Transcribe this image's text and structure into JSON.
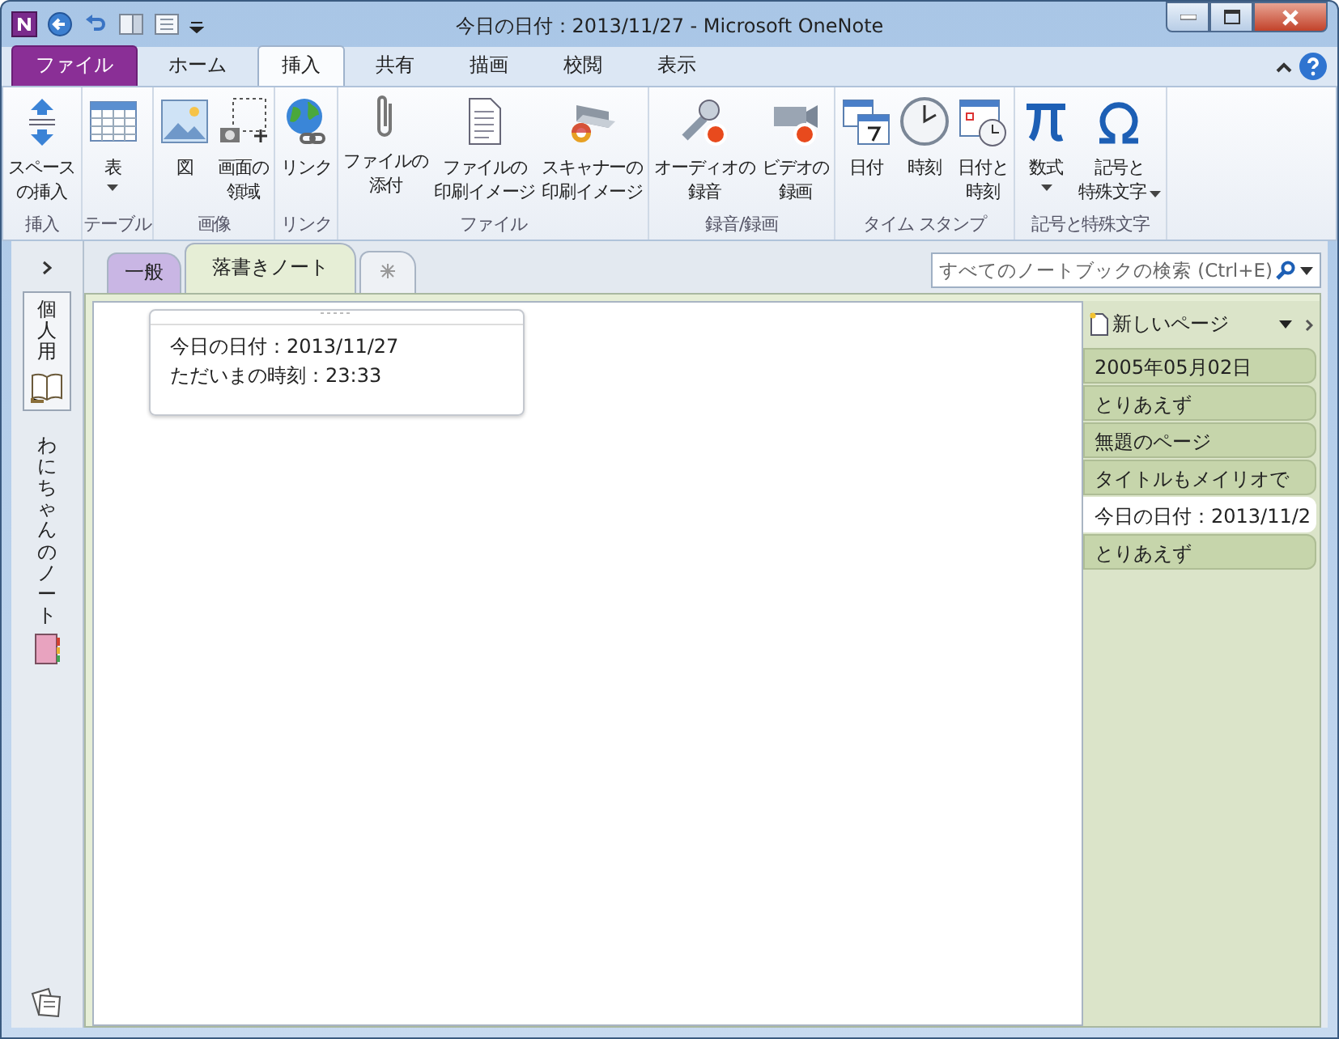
{
  "window": {
    "title": "今日の日付：2013/11/27 - Microsoft OneNote"
  },
  "ribbon_tabs": [
    {
      "label": "ファイル",
      "kind": "file",
      "selected": false
    },
    {
      "label": "ホーム",
      "kind": "tab",
      "selected": false
    },
    {
      "label": "挿入",
      "kind": "tab",
      "selected": true
    },
    {
      "label": "共有",
      "kind": "tab",
      "selected": false
    },
    {
      "label": "描画",
      "kind": "tab",
      "selected": false
    },
    {
      "label": "校閲",
      "kind": "tab",
      "selected": false
    },
    {
      "label": "表示",
      "kind": "tab",
      "selected": false
    }
  ],
  "ribbon_groups": [
    {
      "label": "挿入",
      "buttons": [
        {
          "kind": "space",
          "lines": [
            "スペース",
            "の挿入"
          ],
          "dropdown": false
        }
      ]
    },
    {
      "label": "テーブル",
      "buttons": [
        {
          "kind": "table",
          "lines": [
            "表"
          ],
          "dropdown": true
        }
      ]
    },
    {
      "label": "画像",
      "buttons": [
        {
          "kind": "picture",
          "lines": [
            "図"
          ],
          "dropdown": false
        },
        {
          "kind": "clip",
          "lines": [
            "画面の",
            "領域"
          ],
          "dropdown": false
        }
      ]
    },
    {
      "label": "リンク",
      "buttons": [
        {
          "kind": "link",
          "lines": [
            "リンク"
          ],
          "dropdown": false
        }
      ]
    },
    {
      "label": "ファイル",
      "buttons": [
        {
          "kind": "attach",
          "lines": [
            "ファイルの",
            "添付"
          ],
          "dropdown": false
        },
        {
          "kind": "printout",
          "lines": [
            "ファイルの",
            "印刷イメージ"
          ],
          "dropdown": false
        },
        {
          "kind": "scanner",
          "lines": [
            "スキャナーの",
            "印刷イメージ"
          ],
          "dropdown": false
        }
      ]
    },
    {
      "label": "録音/録画",
      "buttons": [
        {
          "kind": "audio",
          "lines": [
            "オーディオの",
            "録音"
          ],
          "dropdown": false
        },
        {
          "kind": "video",
          "lines": [
            "ビデオの",
            "録画"
          ],
          "dropdown": false
        }
      ]
    },
    {
      "label": "タイム スタンプ",
      "buttons": [
        {
          "kind": "date",
          "lines": [
            "日付"
          ],
          "dropdown": false
        },
        {
          "kind": "time",
          "lines": [
            "時刻"
          ],
          "dropdown": false
        },
        {
          "kind": "datetime",
          "lines": [
            "日付と",
            "時刻"
          ],
          "dropdown": false
        }
      ]
    },
    {
      "label": "記号と特殊文字",
      "buttons": [
        {
          "kind": "equation",
          "lines": [
            "数式"
          ],
          "dropdown": true
        },
        {
          "kind": "symbol",
          "lines": [
            "記号と",
            "特殊文字"
          ],
          "dropdown": true
        }
      ]
    }
  ],
  "notebooks": [
    {
      "label": "個人用",
      "selected": true
    },
    {
      "label": "わにちゃんのノート",
      "selected": false
    }
  ],
  "section_tabs": [
    {
      "label": "一般",
      "color": "#c9b6e4",
      "selected": false
    },
    {
      "label": "落書きノート",
      "color": "#e6eed6",
      "selected": true
    }
  ],
  "search": {
    "placeholder": "すべてのノートブックの検索 (Ctrl+E)"
  },
  "note": {
    "lines": [
      "今日の日付：2013/11/27",
      "ただいまの時刻：23:33"
    ]
  },
  "new_page": {
    "label": "新しいページ"
  },
  "pages": [
    {
      "title": "2005年05月02日",
      "selected": false
    },
    {
      "title": "とりあえず",
      "selected": false
    },
    {
      "title": "無題のページ",
      "selected": false
    },
    {
      "title": "タイトルもメイリオで",
      "selected": false
    },
    {
      "title": "今日の日付：2013/11/2",
      "selected": true
    },
    {
      "title": "とりあえず",
      "selected": false
    }
  ]
}
